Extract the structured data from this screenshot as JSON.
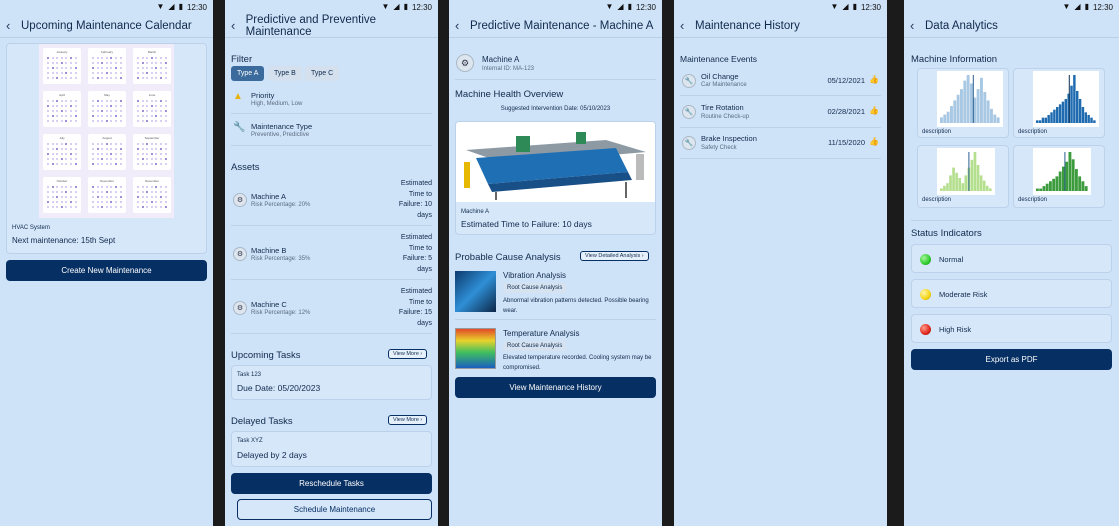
{
  "status_bar": {
    "time": "12:30"
  },
  "screen1": {
    "title": "Upcoming Maintenance Calendar",
    "calendar_months": [
      "January",
      "February",
      "March",
      "April",
      "May",
      "June",
      "July",
      "August",
      "September",
      "October",
      "November",
      "December"
    ],
    "system": "HVAC System",
    "next": "Next maintenance: 15th Sept",
    "button": "Create New Maintenance"
  },
  "screen2": {
    "title": "Predictive and Preventive Maintenance",
    "filter_title": "Filter",
    "filters": [
      "Type A",
      "Type B",
      "Type C"
    ],
    "priority": {
      "title": "Priority",
      "sub": "High, Medium, Low"
    },
    "mtype": {
      "title": "Maintenance Type",
      "sub": "Preventive, Predictive"
    },
    "assets_title": "Assets",
    "assets": [
      {
        "name": "Machine A",
        "risk": "Risk Percentage: 20%",
        "ttf": [
          "Estimated",
          "Time to",
          "Failure: 10",
          "days"
        ]
      },
      {
        "name": "Machine B",
        "risk": "Risk Percentage: 35%",
        "ttf": [
          "Estimated",
          "Time to",
          "Failure: 5",
          "days"
        ]
      },
      {
        "name": "Machine C",
        "risk": "Risk Percentage: 12%",
        "ttf": [
          "Estimated",
          "Time to",
          "Failure: 15",
          "days"
        ]
      }
    ],
    "upcoming_title": "Upcoming Tasks",
    "view_more": "View More",
    "upcoming_task": {
      "name": "Task 123",
      "due": "Due Date: 05/20/2023"
    },
    "delayed_title": "Delayed Tasks",
    "delayed_task": {
      "name": "Task XYZ",
      "delay": "Delayed by 2 days"
    },
    "reschedule": "Reschedule Tasks",
    "schedule": "Schedule Maintenance"
  },
  "screen3": {
    "title": "Predictive Maintenance - Machine A",
    "machine": "Machine A",
    "internal_id": "Internal ID: MA-123",
    "health_title": "Machine Health Overview",
    "suggested": "Suggested Intervention Date: 05/10/2023",
    "card_machine": "Machine A",
    "card_ttf": "Estimated Time to Failure: 10 days",
    "cause_title": "Probable Cause Analysis",
    "detailed": "View Detailed Analysis",
    "causes": [
      {
        "title": "Vibration Analysis",
        "chip": "Root Cause Analysis",
        "desc": "Abnormal vibration patterns detected. Possible bearing wear."
      },
      {
        "title": "Temperature Analysis",
        "chip": "Root Cause Analysis",
        "desc": "Elevated temperature recorded. Cooling system may be compromised."
      }
    ],
    "button": "View Maintenance History"
  },
  "screen4": {
    "title": "Maintenance History",
    "events_title": "Maintenance Events",
    "events": [
      {
        "title": "Oil Change",
        "sub": "Car Maintenance",
        "date": "05/12/2021"
      },
      {
        "title": "Tire Rotation",
        "sub": "Routine Check-up",
        "date": "02/28/2021"
      },
      {
        "title": "Brake Inspection",
        "sub": "Safety Check",
        "date": "11/15/2020"
      }
    ]
  },
  "screen5": {
    "title": "Data Analytics",
    "info_title": "Machine Information",
    "chart_caption": "description",
    "status_title": "Status Indicators",
    "statuses": [
      {
        "label": "Normal",
        "color": "#2ecc2e"
      },
      {
        "label": "Moderate Risk",
        "color": "#f4d313"
      },
      {
        "label": "High Risk",
        "color": "#e0261d"
      }
    ],
    "button": "Export as PDF"
  },
  "colors": {
    "background": "#cfe3f8",
    "primary": "#062f63"
  }
}
